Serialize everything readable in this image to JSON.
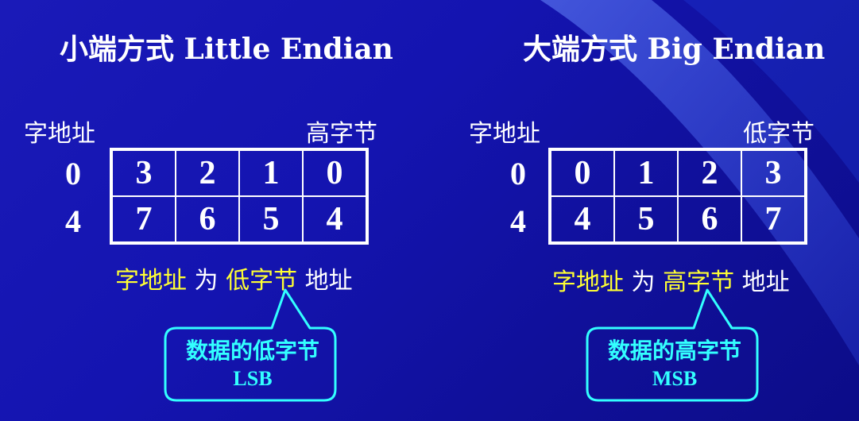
{
  "left": {
    "title": "小端方式 Little Endian",
    "word_addr_label": "字地址",
    "corner_label": "高字节",
    "rows": [
      {
        "addr": "0",
        "bytes": [
          "3",
          "2",
          "1",
          "0"
        ]
      },
      {
        "addr": "4",
        "bytes": [
          "7",
          "6",
          "5",
          "4"
        ]
      }
    ],
    "sentence": {
      "part1": "字地址",
      "part2": " 为 ",
      "part3": "低字节",
      "part4": " 地址"
    },
    "callout": {
      "line1": "数据的低字节",
      "line2": "LSB"
    }
  },
  "right": {
    "title": "大端方式 Big Endian",
    "word_addr_label": "字地址",
    "corner_label": "低字节",
    "rows": [
      {
        "addr": "0",
        "bytes": [
          "0",
          "1",
          "2",
          "3"
        ]
      },
      {
        "addr": "4",
        "bytes": [
          "4",
          "5",
          "6",
          "7"
        ]
      }
    ],
    "sentence": {
      "part1": "字地址",
      "part2": " 为 ",
      "part3": "高字节",
      "part4": " 地址"
    },
    "callout": {
      "line1": "数据的高字节",
      "line2": "MSB"
    }
  },
  "colors": {
    "background": "#1414b0",
    "text": "#ffffff",
    "highlight": "#ffff33",
    "callout": "#33ffff"
  }
}
